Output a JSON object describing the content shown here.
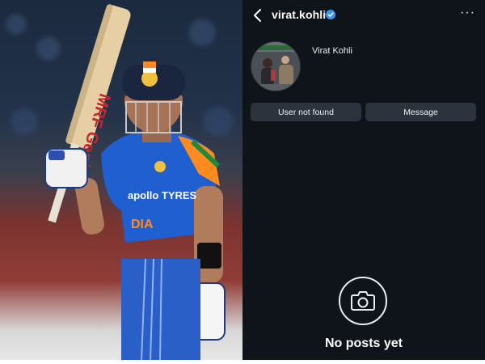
{
  "profile": {
    "username": "virat.kohli",
    "display_name": "Virat Kohli",
    "buttons": {
      "primary_label": "User not found",
      "secondary_label": "Message"
    },
    "empty_state": {
      "message": "No posts yet"
    },
    "icons": {
      "back": "chevron-left-icon",
      "verified": "verified-badge-icon",
      "more": "more-horizontal-icon",
      "camera": "camera-icon"
    },
    "colors": {
      "background": "#0f141b",
      "button": "#2c333c",
      "verified": "#3897f0"
    }
  },
  "photo": {
    "jersey_text": "apollo TYRES",
    "team_text": "DIA",
    "bat_brand": "MRF Genius",
    "colors": {
      "jersey": "#1f5fd0",
      "helmet": "#1a2640"
    }
  }
}
